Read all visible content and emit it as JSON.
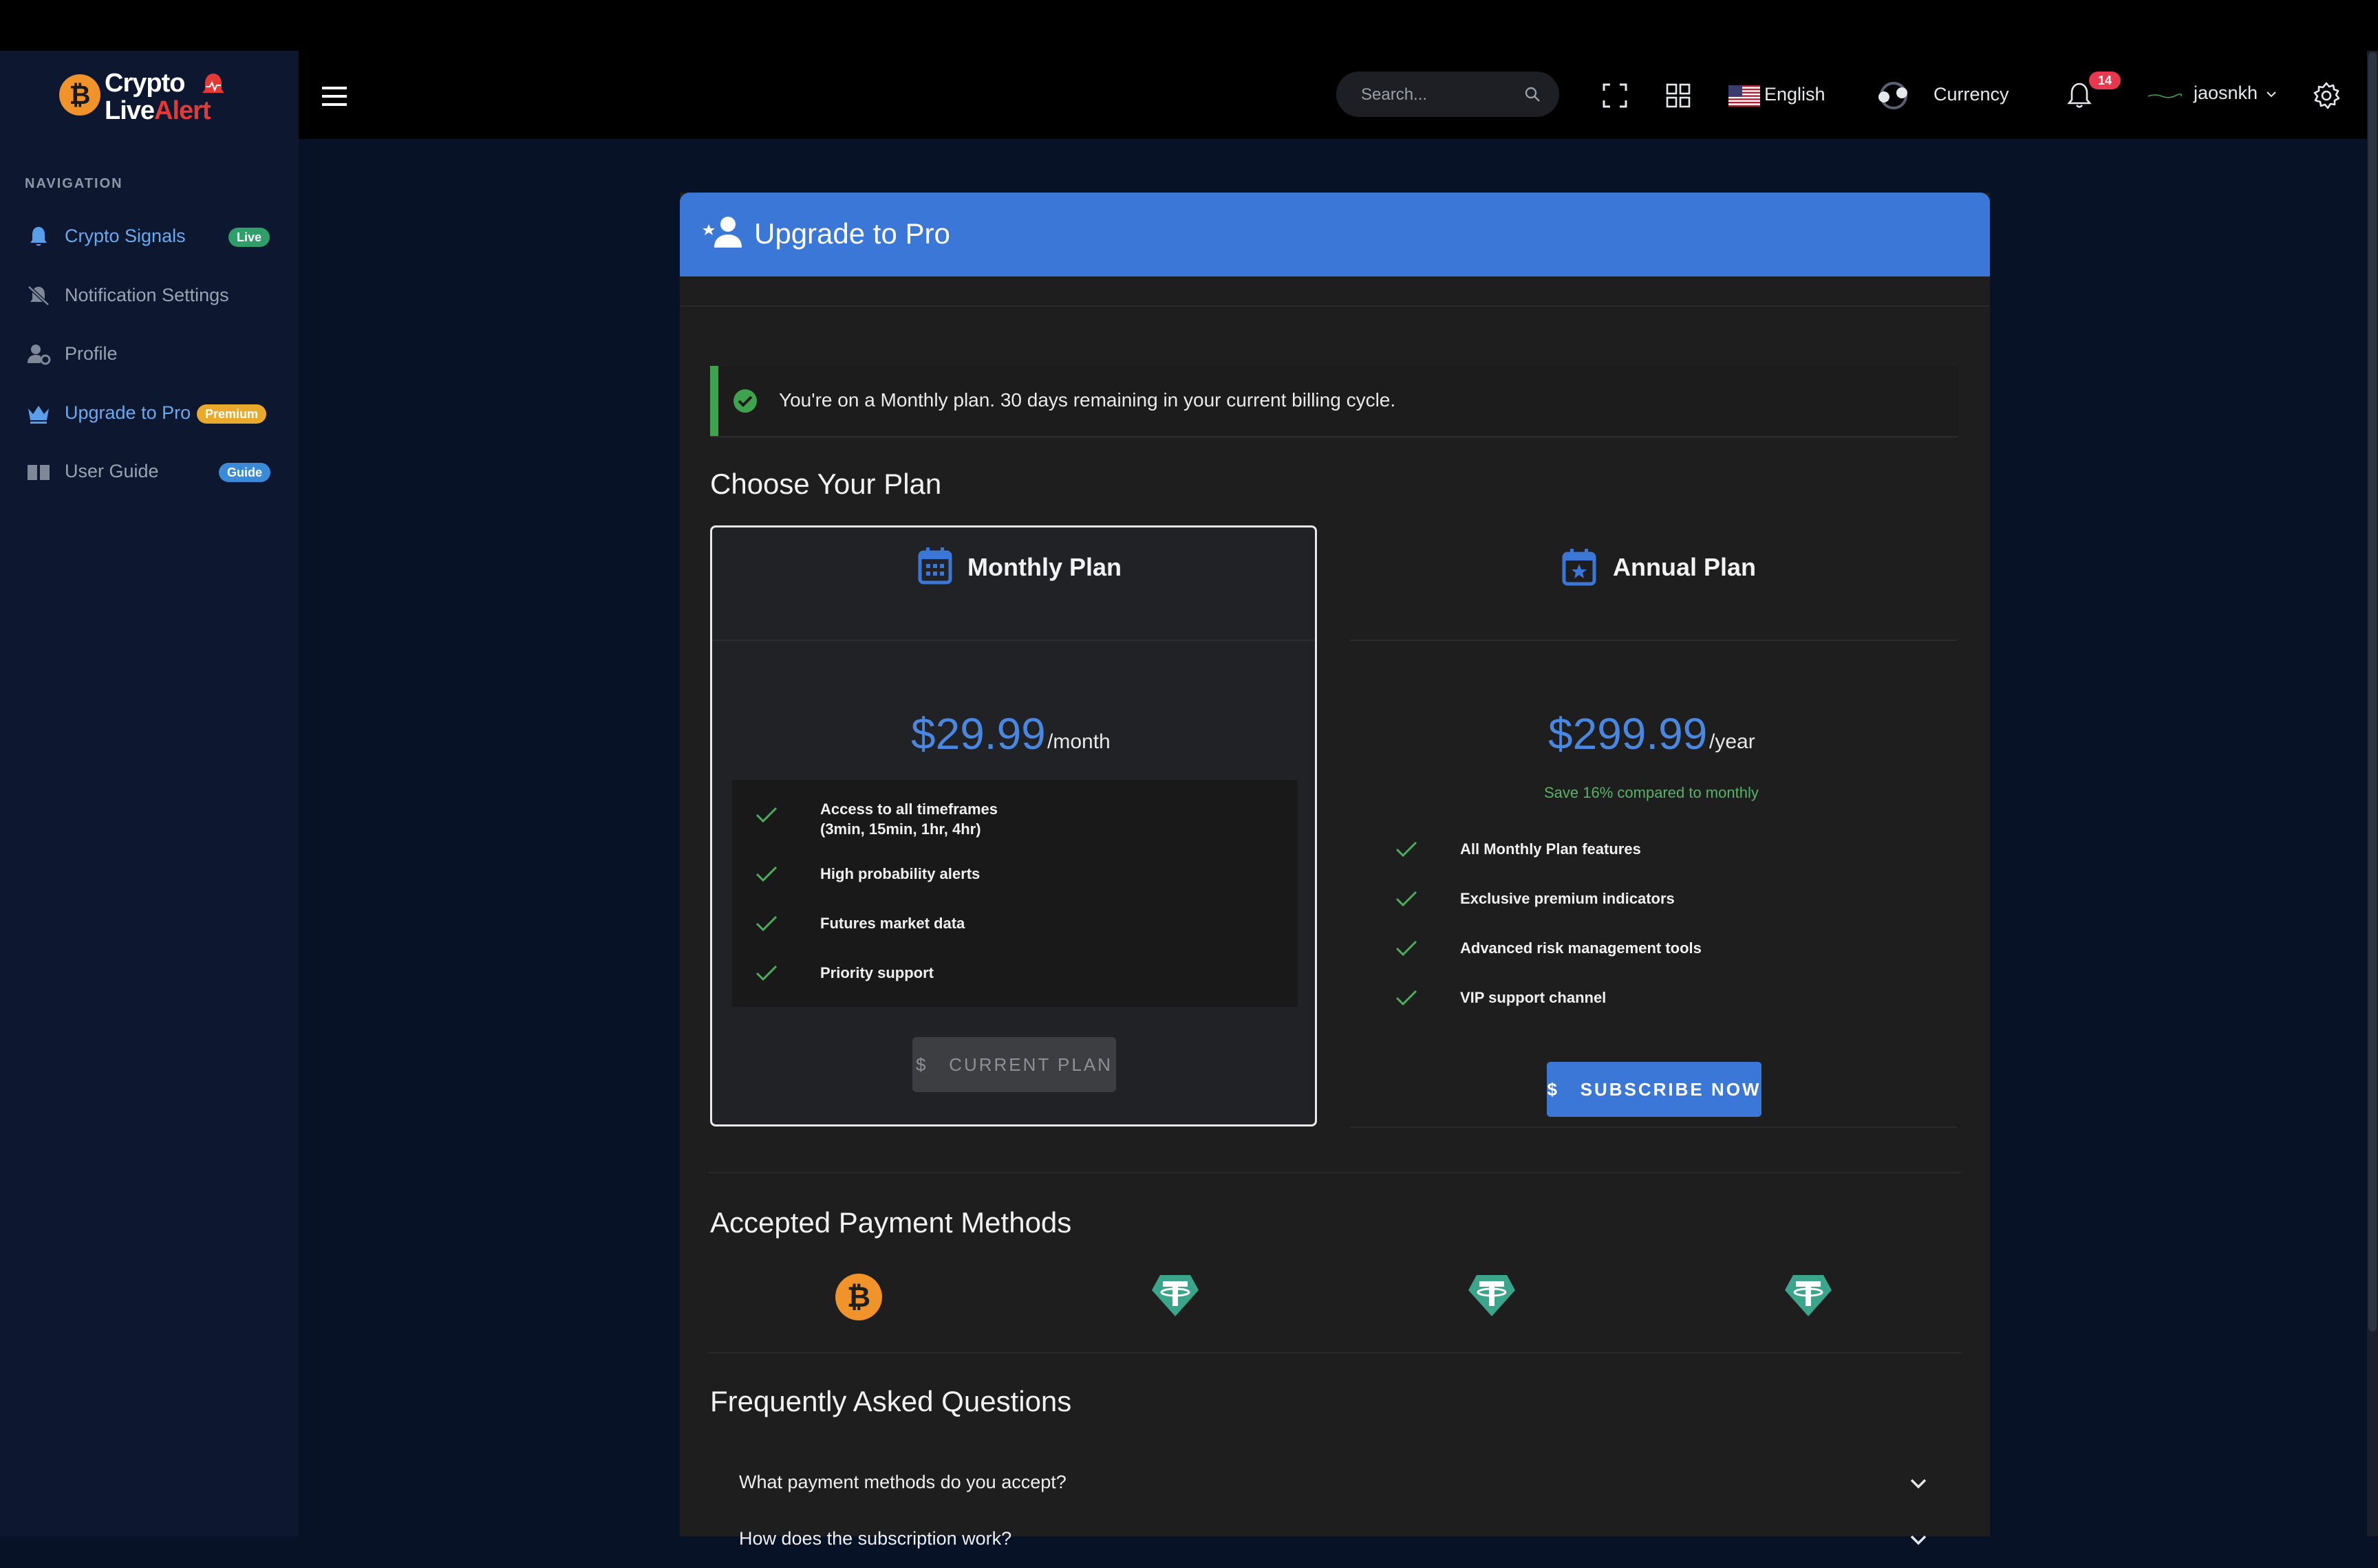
{
  "brand": {
    "line1": "Crypto",
    "line2a": "Live",
    "line2b": "Alert"
  },
  "topbar": {
    "search_placeholder": "Search...",
    "language": "English",
    "currency": "Currency",
    "notifications_count": "14",
    "username": "jaosnkh"
  },
  "sidebar": {
    "heading": "NAVIGATION",
    "items": [
      {
        "label": "Crypto Signals",
        "badge": "Live",
        "active": true
      },
      {
        "label": "Notification Settings",
        "badge": "",
        "active": false
      },
      {
        "label": "Profile",
        "badge": "",
        "active": false
      },
      {
        "label": "Upgrade to Pro",
        "badge": "Premium",
        "active": true
      },
      {
        "label": "User Guide",
        "badge": "Guide",
        "active": false
      }
    ]
  },
  "page": {
    "title": "Upgrade to Pro",
    "alert": "You're on a Monthly plan. 30 days remaining in your current billing cycle.",
    "choose_title": "Choose Your Plan",
    "plans": {
      "monthly": {
        "name": "Monthly Plan",
        "price": "$29.99",
        "period": "/month",
        "features": [
          "Access to all timeframes",
          "(3min, 15min, 1hr, 4hr)",
          "High probability alerts",
          "Futures market data",
          "Priority support"
        ],
        "button": "CURRENT PLAN"
      },
      "annual": {
        "name": "Annual Plan",
        "price": "$299.99",
        "period": "/year",
        "savings": "Save 16% compared to monthly",
        "features": [
          "All Monthly Plan features",
          "Exclusive premium indicators",
          "Advanced risk management tools",
          "VIP support channel"
        ],
        "button": "SUBSCRIBE NOW"
      }
    },
    "payment_title": "Accepted Payment Methods",
    "payment_icons": [
      "bitcoin-icon",
      "tether-icon",
      "tether-icon",
      "tether-icon"
    ],
    "faq_title": "Frequently Asked Questions",
    "faq": [
      "What payment methods do you accept?",
      "How does the subscription work?"
    ]
  },
  "colors": {
    "accent": "#3a77d6",
    "success": "#3fa34d",
    "live_badge": "#2f9e6b",
    "premium_badge": "#e8a92c",
    "guide_badge": "#3a8ad8",
    "bitcoin": "#f0932b",
    "tether": "#3aa58a"
  }
}
